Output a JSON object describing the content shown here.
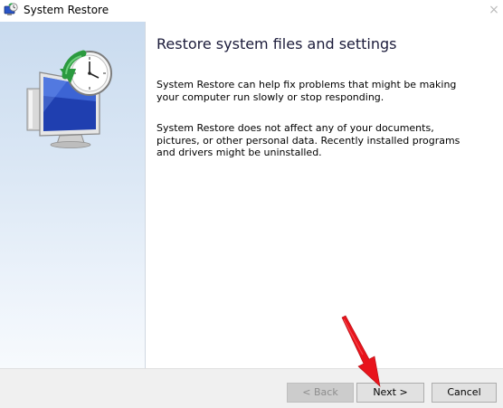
{
  "window": {
    "title": "System Restore",
    "close_glyph": "×"
  },
  "content": {
    "heading": "Restore system files and settings",
    "paragraph1": "System Restore can help fix problems that might be making your computer run slowly or stop responding.",
    "paragraph2": "System Restore does not affect any of your documents, pictures, or other personal data. Recently installed programs and drivers might be uninstalled."
  },
  "buttons": {
    "back": "< Back",
    "next": "Next >",
    "cancel": "Cancel"
  },
  "icons": {
    "title_icon": "system-restore-icon",
    "hero_icon": "computer-clock-restore-icon",
    "annotation": "red-pointer-arrow-icon"
  },
  "colors": {
    "panel_gradient_top": "#c9dbef",
    "annotation_arrow": "#e8141c",
    "button_face": "#e1e1e1",
    "button_disabled": "#cccccc"
  },
  "states": {
    "back_enabled": false
  }
}
